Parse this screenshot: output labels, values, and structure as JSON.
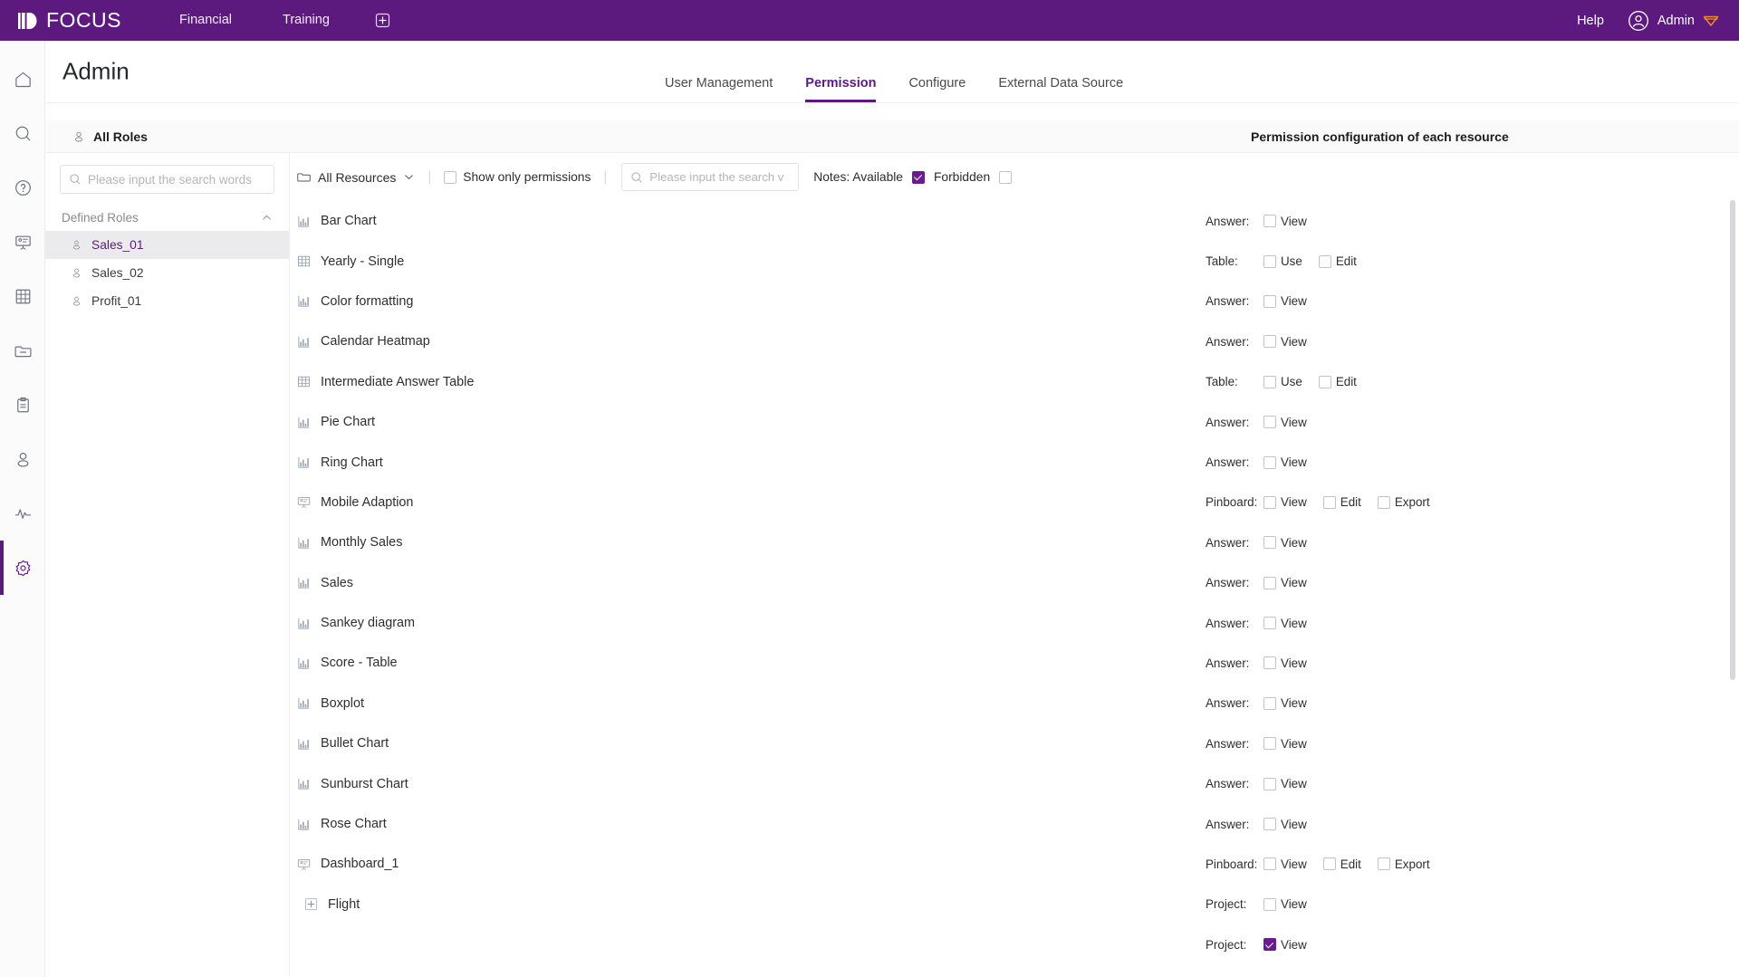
{
  "header": {
    "brand": "FOCUS",
    "brand_icon": "focus-logo-icon",
    "nav": [
      {
        "label": "Financial",
        "name": "financial"
      },
      {
        "label": "Training",
        "name": "training"
      }
    ],
    "add_tab_icon": "plus-box-icon",
    "help_label": "Help",
    "user_name": "Admin",
    "user_icon": "user-circle-icon",
    "user_badge_icon": "diamond-badge-icon",
    "bg_color": "#5c1a7f"
  },
  "rail": {
    "items": [
      {
        "name": "home",
        "icon": "home-icon",
        "active": false
      },
      {
        "name": "search",
        "icon": "search-icon",
        "active": false
      },
      {
        "name": "help",
        "icon": "question-circle-icon",
        "active": false
      },
      {
        "name": "presentation",
        "icon": "presentation-icon",
        "active": false
      },
      {
        "name": "table",
        "icon": "grid-table-icon",
        "active": false
      },
      {
        "name": "folder",
        "icon": "folder-minus-icon",
        "active": false
      },
      {
        "name": "clipboard",
        "icon": "clipboard-icon",
        "active": false
      },
      {
        "name": "user",
        "icon": "user-icon",
        "active": false
      },
      {
        "name": "monitor",
        "icon": "activity-pulse-icon",
        "active": false
      },
      {
        "name": "settings",
        "icon": "gear-icon",
        "active": true
      }
    ],
    "active_color": "#5c1a7f"
  },
  "page": {
    "title": "Admin",
    "tabs": [
      {
        "label": "User Management",
        "name": "user-management",
        "active": false
      },
      {
        "label": "Permission",
        "name": "permission",
        "active": true
      },
      {
        "label": "Configure",
        "name": "configure",
        "active": false
      },
      {
        "label": "External Data Source",
        "name": "external-data-source",
        "active": false
      }
    ],
    "accent_color": "#5c1a7f"
  },
  "section": {
    "roles_header": "All Roles",
    "roles_header_icon": "user-outline-icon",
    "permission_header": "Permission configuration of each resource"
  },
  "roles_panel": {
    "search_placeholder": "Please input the search words",
    "search_value": "",
    "search_icon": "search-icon",
    "group_label": "Defined Roles",
    "collapse_icon": "chevron-up-icon",
    "roles": [
      {
        "label": "Sales_01",
        "selected": true
      },
      {
        "label": "Sales_02",
        "selected": false
      },
      {
        "label": "Profit_01",
        "selected": false
      }
    ]
  },
  "filter_bar": {
    "all_resources_label": "All Resources",
    "all_resources_icon": "folder-icon",
    "dropdown_icon": "chevron-down-icon",
    "show_only_permissions_label": "Show only permissions",
    "show_only_permissions_checked": false,
    "search_placeholder": "Please input the search v",
    "search_value": "",
    "search_icon": "search-icon",
    "notes_label": "Notes: Available",
    "available_checked": true,
    "forbidden_label": "Forbidden",
    "forbidden_checked": false,
    "checked_color": "#6a1b8f"
  },
  "rows": [
    {
      "name": "Bar Chart",
      "icon": "bar-chart-icon",
      "indent": 0,
      "perm_label": "Answer:",
      "options": [
        {
          "label": "View",
          "checked": false
        }
      ]
    },
    {
      "name": "Yearly - Single",
      "icon": "grid-table-icon",
      "indent": 0,
      "perm_label": "Table:",
      "options": [
        {
          "label": "Use",
          "checked": false
        },
        {
          "label": "Edit",
          "checked": false
        }
      ]
    },
    {
      "name": "Color formatting",
      "icon": "bar-chart-icon",
      "indent": 0,
      "perm_label": "Answer:",
      "options": [
        {
          "label": "View",
          "checked": false
        }
      ]
    },
    {
      "name": "Calendar Heatmap",
      "icon": "bar-chart-icon",
      "indent": 0,
      "perm_label": "Answer:",
      "options": [
        {
          "label": "View",
          "checked": false
        }
      ]
    },
    {
      "name": "Intermediate Answer Table",
      "icon": "grid-table-icon",
      "indent": 0,
      "perm_label": "Table:",
      "options": [
        {
          "label": "Use",
          "checked": false
        },
        {
          "label": "Edit",
          "checked": false
        }
      ]
    },
    {
      "name": "Pie Chart",
      "icon": "bar-chart-icon",
      "indent": 0,
      "perm_label": "Answer:",
      "options": [
        {
          "label": "View",
          "checked": false
        }
      ]
    },
    {
      "name": "Ring Chart",
      "icon": "bar-chart-icon",
      "indent": 0,
      "perm_label": "Answer:",
      "options": [
        {
          "label": "View",
          "checked": false
        }
      ]
    },
    {
      "name": "Mobile Adaption",
      "icon": "presentation-icon",
      "indent": 0,
      "perm_label": "Pinboard:",
      "options": [
        {
          "label": "View",
          "checked": false
        },
        {
          "label": "Edit",
          "checked": false
        },
        {
          "label": "Export",
          "checked": false
        }
      ]
    },
    {
      "name": "Monthly Sales",
      "icon": "bar-chart-icon",
      "indent": 0,
      "perm_label": "Answer:",
      "options": [
        {
          "label": "View",
          "checked": false
        }
      ]
    },
    {
      "name": "Sales",
      "icon": "bar-chart-icon",
      "indent": 0,
      "perm_label": "Answer:",
      "options": [
        {
          "label": "View",
          "checked": false
        }
      ]
    },
    {
      "name": "Sankey diagram",
      "icon": "bar-chart-icon",
      "indent": 0,
      "perm_label": "Answer:",
      "options": [
        {
          "label": "View",
          "checked": false
        }
      ]
    },
    {
      "name": "Score - Table",
      "icon": "bar-chart-icon",
      "indent": 0,
      "perm_label": "Answer:",
      "options": [
        {
          "label": "View",
          "checked": false
        }
      ]
    },
    {
      "name": "Boxplot",
      "icon": "bar-chart-icon",
      "indent": 0,
      "perm_label": "Answer:",
      "options": [
        {
          "label": "View",
          "checked": false
        }
      ]
    },
    {
      "name": "Bullet Chart",
      "icon": "bar-chart-icon",
      "indent": 0,
      "perm_label": "Answer:",
      "options": [
        {
          "label": "View",
          "checked": false
        }
      ]
    },
    {
      "name": "Sunburst Chart",
      "icon": "bar-chart-icon",
      "indent": 0,
      "perm_label": "Answer:",
      "options": [
        {
          "label": "View",
          "checked": false
        }
      ]
    },
    {
      "name": "Rose Chart",
      "icon": "bar-chart-icon",
      "indent": 0,
      "perm_label": "Answer:",
      "options": [
        {
          "label": "View",
          "checked": false
        }
      ]
    },
    {
      "name": "Dashboard_1",
      "icon": "presentation-icon",
      "indent": 0,
      "perm_label": "Pinboard:",
      "options": [
        {
          "label": "View",
          "checked": false
        },
        {
          "label": "Edit",
          "checked": false
        },
        {
          "label": "Export",
          "checked": false
        }
      ]
    },
    {
      "name": "Flight",
      "icon": "plus-box-icon",
      "indent": 1,
      "perm_label": "Project:",
      "options": [
        {
          "label": "View",
          "checked": false
        }
      ]
    },
    {
      "name": "",
      "icon": "none",
      "indent": 0,
      "perm_label": "Project:",
      "options": [
        {
          "label": "View",
          "checked": true
        }
      ]
    }
  ]
}
